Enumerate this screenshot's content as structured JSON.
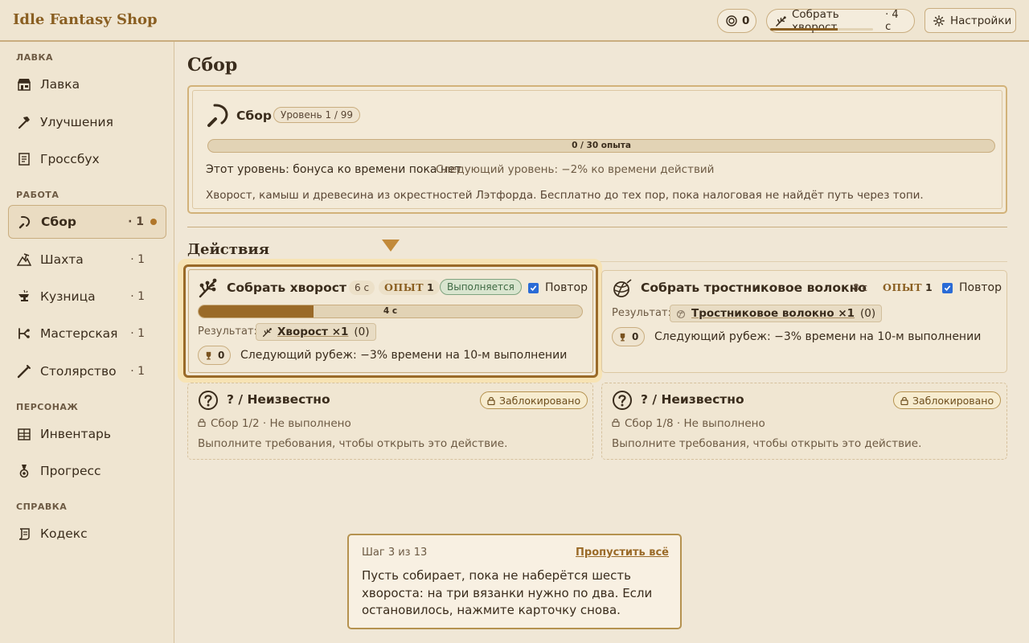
{
  "app": {
    "title": "Idle Fantasy Shop",
    "coins": "0",
    "current_action": "Собрать хворост",
    "current_action_time": "· 4 с",
    "current_action_progress": 0.66,
    "settings_label": "Настройки"
  },
  "sidebar": {
    "sections": [
      {
        "label": "ЛАВКА",
        "items": [
          {
            "label": "Лавка",
            "icon": "shop-icon"
          },
          {
            "label": "Улучшения",
            "icon": "hammer-icon"
          },
          {
            "label": "Гроссбух",
            "icon": "ledger-icon"
          }
        ]
      },
      {
        "label": "РАБОТА",
        "items": [
          {
            "label": "Сбор",
            "icon": "sickle-icon",
            "count": "· 1",
            "active": true
          },
          {
            "label": "Шахта",
            "icon": "mine-icon",
            "count": "· 1"
          },
          {
            "label": "Кузница",
            "icon": "anvil-icon",
            "count": "· 1"
          },
          {
            "label": "Мастерская",
            "icon": "workshop-icon",
            "count": "· 1"
          },
          {
            "label": "Столярство",
            "icon": "saw-icon",
            "count": "· 1"
          }
        ]
      },
      {
        "label": "ПЕРСОНАЖ",
        "items": [
          {
            "label": "Инвентарь",
            "icon": "inventory-icon"
          },
          {
            "label": "Прогресс",
            "icon": "medal-icon"
          }
        ]
      },
      {
        "label": "СПРАВКА",
        "items": [
          {
            "label": "Кодекс",
            "icon": "scroll-icon"
          }
        ]
      }
    ]
  },
  "main": {
    "page_title": "Сбор",
    "skill": {
      "name": "Сбор",
      "level_badge": "Уровень 1 / 99",
      "xp_label": "0 / 30 опыта",
      "xp_progress": 0.0,
      "current_bonus": "Этот уровень: бонуса ко времени пока нет",
      "next_bonus": "Следующий уровень: −2% ко времени действий",
      "description": "Хворост, камыш и древесина из окрестностей Лэтфорда. Бесплатно до тех пор, пока налоговая не найдёт путь через топи."
    },
    "actions_title": "Действия",
    "actions": [
      {
        "title": "Собрать хворост",
        "time": "6 с",
        "xp_label": "ОПЫТ",
        "xp_value": "1",
        "status": "Выполняется",
        "repeat_label": "Повтор",
        "progress_label": "4 с",
        "progress": 0.3,
        "result_label": "Результат:",
        "result_item": "Хворост ×1",
        "result_count": "(0)",
        "trophy_count": "0",
        "milestone": "Следующий рубеж: −3% времени на 10-м выполнении"
      },
      {
        "title": "Собрать тростниковое волокно",
        "time": "8 с",
        "xp_label": "ОПЫТ",
        "xp_value": "1",
        "repeat_label": "Повтор",
        "result_label": "Результат:",
        "result_item": "Тростниковое волокно ×1",
        "result_count": "(0)",
        "trophy_count": "0",
        "milestone": "Следующий рубеж: −3% времени на 10-м выполнении"
      },
      {
        "title": "? / Неизвестно",
        "locked_label": "Заблокировано",
        "requirement": "Сбор 1/2 · Не выполнено",
        "hint": "Выполните требования, чтобы открыть это действие."
      },
      {
        "title": "? / Неизвестно",
        "locked_label": "Заблокировано",
        "requirement": "Сбор 1/8 · Не выполнено",
        "hint": "Выполните требования, чтобы открыть это действие."
      }
    ]
  },
  "tour": {
    "step": "Шаг 3 из 13",
    "skip_label": "Пропустить всё",
    "text": "Пусть собирает, пока не наберётся шесть хвороста: на три вязанки нужно по два. Если остановилось, нажмите карточку снова."
  },
  "colors": {
    "accent": "#9a6a28",
    "brand": "#8a5f22",
    "background": "#f0e7d6",
    "running_green": "#3f6a44",
    "checkbox_blue": "#2a6bd6"
  }
}
